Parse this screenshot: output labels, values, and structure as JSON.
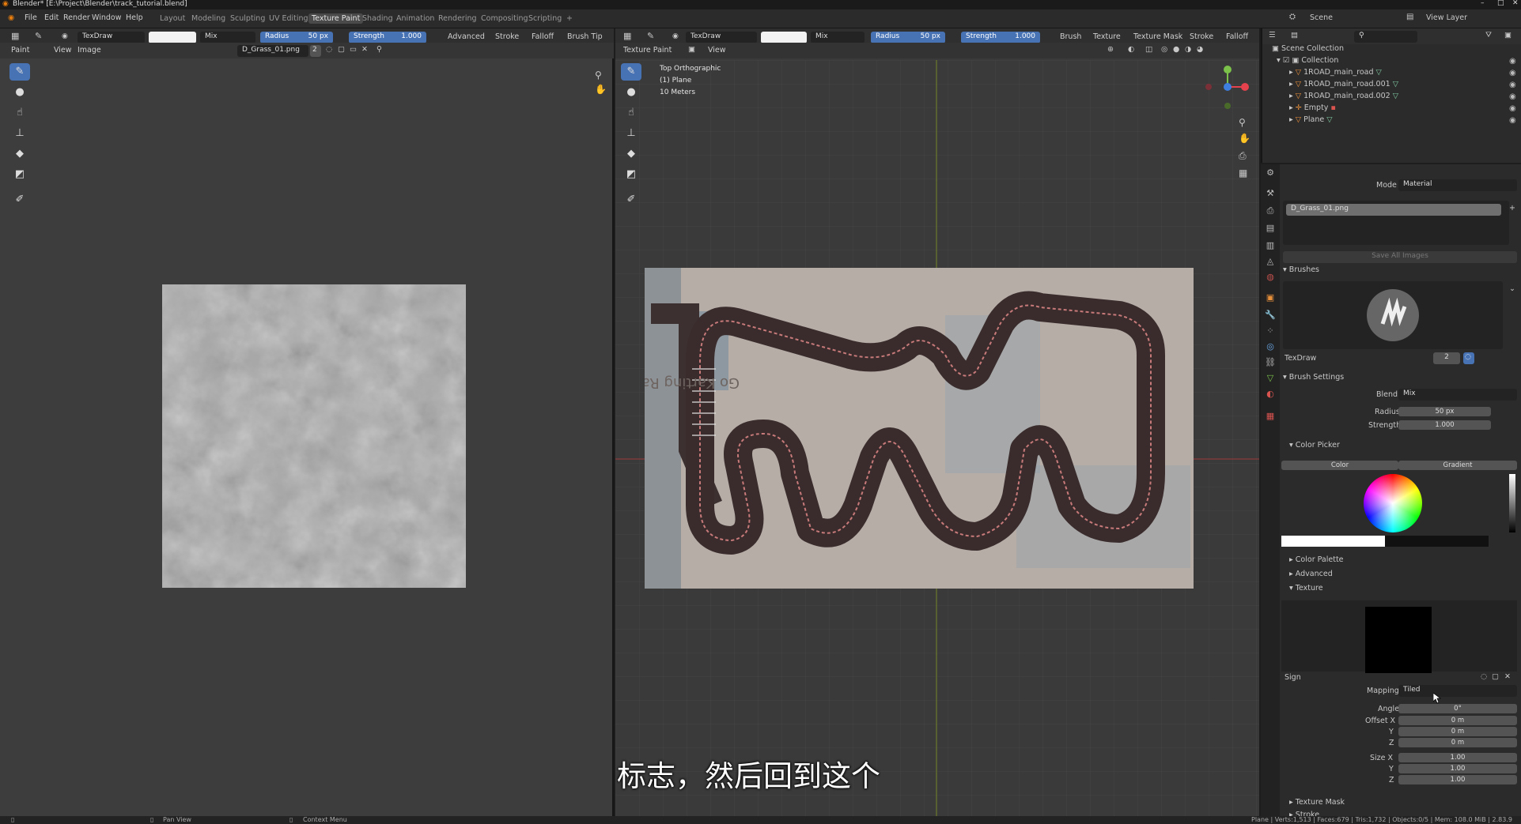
{
  "title": "Blender* [E:\\Project\\Blender\\track_tutorial.blend]",
  "menus": [
    "File",
    "Edit",
    "Render",
    "Window",
    "Help"
  ],
  "workspaces": [
    "Layout",
    "Modeling",
    "Sculpting",
    "UV Editing",
    "Texture Paint",
    "Shading",
    "Animation",
    "Rendering",
    "Compositing",
    "Scripting"
  ],
  "scene": "Scene",
  "view_layer": "View Layer",
  "left": {
    "brush": "TexDraw",
    "blend": "Mix",
    "radius_label": "Radius",
    "radius": "50 px",
    "strength_label": "Strength",
    "strength": "1.000",
    "menus": [
      "Advanced",
      "Stroke",
      "Falloff",
      "Brush Tip"
    ],
    "mode": "Paint",
    "view": "View",
    "image_menu": "Image",
    "image": "D_Grass_01.png",
    "users": "2"
  },
  "viewport": {
    "brush": "TexDraw",
    "blend": "Mix",
    "radius_label": "Radius",
    "radius": "50 px",
    "strength_label": "Strength",
    "strength": "1.000",
    "menus": [
      "Brush",
      "Texture",
      "Texture Mask",
      "Stroke",
      "Falloff"
    ],
    "mode": "Texture Paint",
    "view": "View",
    "overlay1": "Top Orthographic",
    "overlay2": "(1) Plane",
    "overlay3": "10 Meters",
    "track_text": "Go Karting Raceway"
  },
  "outliner": {
    "root": "Scene Collection",
    "collection": "Collection",
    "items": [
      "1ROAD_main_road",
      "1ROAD_main_road.001",
      "1ROAD_main_road.002",
      "Empty",
      "Plane"
    ]
  },
  "props": {
    "mode_label": "Mode",
    "mode": "Material",
    "image_slot": "D_Grass_01.png",
    "save_all": "Save All Images",
    "brushes": "Brushes",
    "brush_name": "TexDraw",
    "brush_users": "2",
    "brush_settings": "Brush Settings",
    "blend_label": "Blend",
    "blend": "Mix",
    "radius_label": "Radius",
    "radius": "50 px",
    "strength_label": "Strength",
    "strength": "1.000",
    "color_picker": "Color Picker",
    "tab_color": "Color",
    "tab_gradient": "Gradient",
    "color_palette": "Color Palette",
    "advanced": "Advanced",
    "texture": "Texture",
    "tex_name": "Sign",
    "mapping_label": "Mapping",
    "mapping": "Tiled",
    "angle_label": "Angle",
    "angle": "0°",
    "offset_x_label": "Offset X",
    "offset_x": "0 m",
    "offset_y_label": "Y",
    "offset_y": "0 m",
    "offset_z_label": "Z",
    "offset_z": "0 m",
    "size_x_label": "Size X",
    "size_x": "1.00",
    "size_y_label": "Y",
    "size_y": "1.00",
    "size_z_label": "Z",
    "size_z": "1.00",
    "texture_mask": "Texture Mask",
    "stroke": "Stroke"
  },
  "subtitle": "标志，然后回到这个",
  "status": {
    "pan": "Pan View",
    "context": "Context Menu",
    "stats": "Plane | Verts:1,513 | Faces:679 | Tris:1,732 | Objects:0/5 | Mem: 108.0 MiB | 2.83.9"
  }
}
